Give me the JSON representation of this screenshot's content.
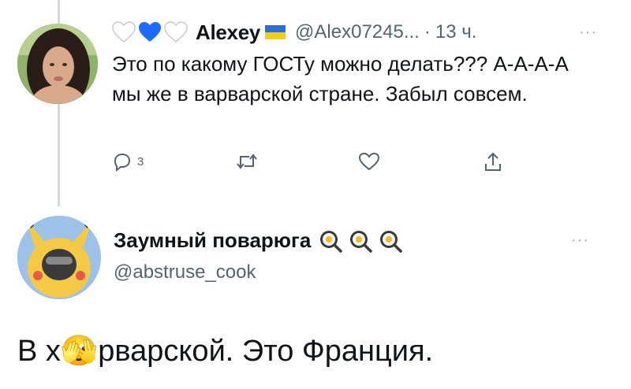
{
  "tweet1": {
    "author_name": "Alexey",
    "handle": "@Alex07245...",
    "separator": "·",
    "time": "13 ч.",
    "more": "···",
    "text": "Это по какому ГОСТу можно делать??? А-А-А-А мы же в варварской стране. Забыл совсем.",
    "reply_count": "3",
    "heart_colors": [
      "#ffffff",
      "#1d6bff",
      "#ffffff"
    ],
    "flag_colors": [
      "#2b6fd6",
      "#f2cf1e"
    ],
    "icons": [
      "reply-icon",
      "retweet-icon",
      "like-icon",
      "share-icon"
    ]
  },
  "tweet2": {
    "author_name": "Заумный поварюга",
    "handle": "@abstruse_cook",
    "more": "···",
    "text": "В х🫣рварской. Это Франция.",
    "name_emoji": [
      "frying-pan-egg-icon",
      "frying-pan-egg-icon",
      "frying-pan-egg-icon"
    ]
  },
  "colors": {
    "text": "#0f1419",
    "secondary": "#536471",
    "thread_line": "#cfd9de"
  }
}
